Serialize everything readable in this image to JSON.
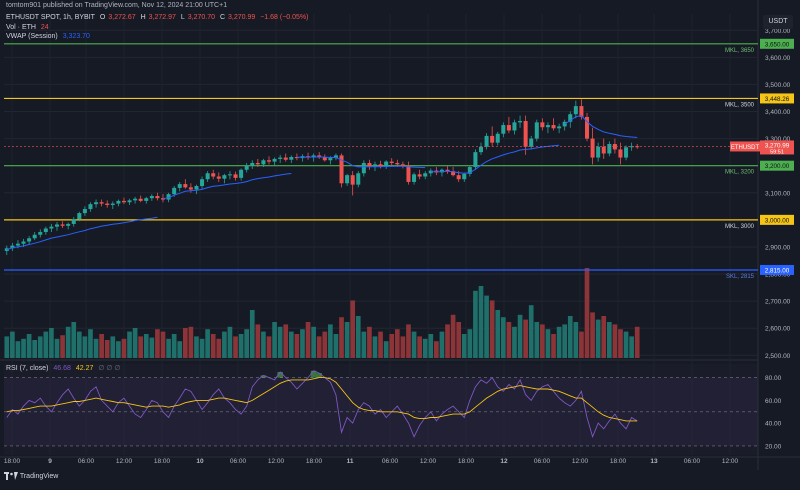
{
  "header": {
    "published": "tomtom901 published on TradingView.com, Nov 12, 2024 21:00 UTC+1",
    "symbol_line": "ETHUSDT SPOT, 1h, BYBIT",
    "o_label": "O",
    "o_value": "3,272.67",
    "h_label": "H",
    "h_value": "3,272.97",
    "l_label": "L",
    "l_value": "3,270.70",
    "c_label": "C",
    "c_value": "3,270.99",
    "change": "−1.68 (−0.05%)",
    "vol_label": "Vol · ETH",
    "vol_value": "24",
    "vwap_label": "VWAP (Session)",
    "vwap_value": "3,323.70",
    "rsi_label": "RSI (7, close)",
    "rsi_value1": "46.68",
    "rsi_value2": "42.27",
    "currency_badge": "USDT"
  },
  "footer": {
    "brand": "TradingView"
  },
  "colors": {
    "background": "#161a25",
    "up": "#26a69a",
    "down": "#ef5350",
    "up_volume": "#1f6f6a",
    "down_volume": "#8c3437",
    "vwap": "#2962ff",
    "green_level": "#4caf50",
    "yellow_level": "#f5c518",
    "blue_level": "#2962ff",
    "rsi_line": "#7e57c2",
    "rsi_ma": "#f5c518"
  },
  "chart_data": [
    {
      "type": "candlestick",
      "title": "ETHUSDT SPOT, 1h, BYBIT",
      "x_tick_labels": [
        "18:00",
        "9",
        "06:00",
        "12:00",
        "18:00",
        "10",
        "06:00",
        "12:00",
        "18:00",
        "11",
        "06:00",
        "12:00",
        "18:00",
        "12",
        "06:00",
        "12:00",
        "18:00",
        "13",
        "06:00",
        "12:00"
      ],
      "y_ticks": [
        "3,700.00",
        "3,600.00",
        "3,500.00",
        "3,400.00",
        "3,300.00",
        "3,200.00",
        "3,100.00",
        "3,000.00",
        "2,900.00",
        "2,800.00",
        "2,700.00",
        "2,600.00",
        "2,500.00"
      ],
      "ylim": [
        2490,
        3760
      ],
      "grid": true,
      "ohlc": [
        [
          2885,
          2905,
          2870,
          2895
        ],
        [
          2895,
          2915,
          2885,
          2905
        ],
        [
          2905,
          2925,
          2895,
          2912
        ],
        [
          2912,
          2930,
          2900,
          2920
        ],
        [
          2920,
          2940,
          2910,
          2932
        ],
        [
          2932,
          2955,
          2925,
          2945
        ],
        [
          2945,
          2965,
          2935,
          2955
        ],
        [
          2955,
          2975,
          2945,
          2968
        ],
        [
          2968,
          2985,
          2955,
          2975
        ],
        [
          2975,
          2992,
          2960,
          2983
        ],
        [
          2983,
          2995,
          2970,
          2978
        ],
        [
          2978,
          2990,
          2965,
          2985
        ],
        [
          2985,
          3010,
          2975,
          3002
        ],
        [
          3002,
          3030,
          2995,
          3025
        ],
        [
          3025,
          3050,
          3015,
          3040
        ],
        [
          3040,
          3065,
          3030,
          3058
        ],
        [
          3058,
          3075,
          3045,
          3065
        ],
        [
          3065,
          3075,
          3050,
          3060
        ],
        [
          3060,
          3072,
          3045,
          3055
        ],
        [
          3055,
          3068,
          3040,
          3060
        ],
        [
          3060,
          3075,
          3050,
          3070
        ],
        [
          3070,
          3082,
          3058,
          3065
        ],
        [
          3065,
          3078,
          3055,
          3072
        ],
        [
          3072,
          3085,
          3060,
          3078
        ],
        [
          3078,
          3090,
          3065,
          3070
        ],
        [
          3070,
          3085,
          3060,
          3080
        ],
        [
          3080,
          3095,
          3070,
          3088
        ],
        [
          3088,
          3100,
          3072,
          3080
        ],
        [
          3080,
          3095,
          3065,
          3075
        ],
        [
          3075,
          3100,
          3065,
          3095
        ],
        [
          3095,
          3125,
          3085,
          3118
        ],
        [
          3118,
          3140,
          3105,
          3132
        ],
        [
          3132,
          3150,
          3115,
          3120
        ],
        [
          3120,
          3135,
          3100,
          3112
        ],
        [
          3112,
          3130,
          3095,
          3125
        ],
        [
          3125,
          3160,
          3115,
          3150
        ],
        [
          3150,
          3180,
          3140,
          3172
        ],
        [
          3172,
          3185,
          3150,
          3160
        ],
        [
          3160,
          3175,
          3140,
          3152
        ],
        [
          3152,
          3170,
          3135,
          3165
        ],
        [
          3165,
          3180,
          3150,
          3168
        ],
        [
          3168,
          3178,
          3145,
          3155
        ],
        [
          3155,
          3190,
          3145,
          3185
        ],
        [
          3185,
          3210,
          3175,
          3200
        ],
        [
          3200,
          3220,
          3188,
          3210
        ],
        [
          3210,
          3225,
          3195,
          3205
        ],
        [
          3205,
          3225,
          3195,
          3220
        ],
        [
          3220,
          3235,
          3205,
          3215
        ],
        [
          3215,
          3230,
          3200,
          3225
        ],
        [
          3225,
          3240,
          3210,
          3230
        ],
        [
          3230,
          3245,
          3215,
          3222
        ],
        [
          3222,
          3238,
          3210,
          3232
        ],
        [
          3232,
          3245,
          3220,
          3228
        ],
        [
          3228,
          3242,
          3215,
          3235
        ],
        [
          3235,
          3248,
          3222,
          3230
        ],
        [
          3230,
          3245,
          3215,
          3238
        ],
        [
          3238,
          3250,
          3225,
          3232
        ],
        [
          3232,
          3242,
          3215,
          3220
        ],
        [
          3220,
          3235,
          3205,
          3228
        ],
        [
          3228,
          3245,
          3220,
          3238
        ],
        [
          3238,
          3245,
          3120,
          3135
        ],
        [
          3135,
          3170,
          3125,
          3165
        ],
        [
          3165,
          3180,
          3090,
          3130
        ],
        [
          3130,
          3180,
          3120,
          3172
        ],
        [
          3172,
          3220,
          3160,
          3210
        ],
        [
          3210,
          3222,
          3185,
          3198
        ],
        [
          3198,
          3215,
          3180,
          3205
        ],
        [
          3205,
          3218,
          3190,
          3195
        ],
        [
          3195,
          3220,
          3188,
          3215
        ],
        [
          3215,
          3228,
          3200,
          3210
        ],
        [
          3210,
          3222,
          3195,
          3205
        ],
        [
          3205,
          3215,
          3190,
          3200
        ],
        [
          3200,
          3215,
          3130,
          3140
        ],
        [
          3140,
          3175,
          3130,
          3168
        ],
        [
          3168,
          3185,
          3150,
          3160
        ],
        [
          3160,
          3180,
          3150,
          3172
        ],
        [
          3172,
          3190,
          3160,
          3182
        ],
        [
          3182,
          3195,
          3165,
          3175
        ],
        [
          3175,
          3190,
          3160,
          3185
        ],
        [
          3185,
          3200,
          3170,
          3180
        ],
        [
          3180,
          3195,
          3160,
          3165
        ],
        [
          3165,
          3180,
          3140,
          3150
        ],
        [
          3150,
          3175,
          3140,
          3170
        ],
        [
          3170,
          3200,
          3160,
          3195
        ],
        [
          3195,
          3260,
          3185,
          3250
        ],
        [
          3250,
          3285,
          3240,
          3270
        ],
        [
          3270,
          3320,
          3260,
          3310
        ],
        [
          3310,
          3345,
          3270,
          3285
        ],
        [
          3285,
          3325,
          3275,
          3318
        ],
        [
          3318,
          3360,
          3305,
          3350
        ],
        [
          3350,
          3380,
          3320,
          3330
        ],
        [
          3330,
          3370,
          3315,
          3360
        ],
        [
          3360,
          3385,
          3340,
          3365
        ],
        [
          3365,
          3385,
          3240,
          3270
        ],
        [
          3270,
          3310,
          3260,
          3300
        ],
        [
          3300,
          3370,
          3290,
          3360
        ],
        [
          3360,
          3375,
          3330,
          3342
        ],
        [
          3342,
          3360,
          3320,
          3350
        ],
        [
          3350,
          3375,
          3330,
          3338
        ],
        [
          3338,
          3355,
          3320,
          3345
        ],
        [
          3345,
          3370,
          3330,
          3362
        ],
        [
          3362,
          3400,
          3340,
          3390
        ],
        [
          3390,
          3440,
          3375,
          3420
        ],
        [
          3420,
          3445,
          3370,
          3380
        ],
        [
          3380,
          3395,
          3290,
          3300
        ],
        [
          3300,
          3340,
          3205,
          3230
        ],
        [
          3230,
          3285,
          3215,
          3270
        ],
        [
          3270,
          3300,
          3225,
          3245
        ],
        [
          3245,
          3290,
          3235,
          3280
        ],
        [
          3280,
          3300,
          3245,
          3260
        ],
        [
          3260,
          3285,
          3205,
          3230
        ],
        [
          3230,
          3275,
          3220,
          3268
        ],
        [
          3268,
          3285,
          3255,
          3272
        ],
        [
          3272,
          3280,
          3262,
          3271
        ]
      ],
      "vwap_note": "VWAP (Session)",
      "volume_label": "Vol · ETH",
      "volume": [
        18,
        22,
        14,
        16,
        20,
        15,
        18,
        22,
        25,
        16,
        19,
        26,
        30,
        22,
        18,
        24,
        16,
        20,
        15,
        18,
        14,
        16,
        22,
        25,
        18,
        20,
        17,
        24,
        22,
        16,
        20,
        14,
        25,
        26,
        18,
        16,
        24,
        20,
        16,
        22,
        26,
        18,
        20,
        24,
        40,
        28,
        22,
        18,
        30,
        26,
        28,
        22,
        20,
        24,
        30,
        26,
        18,
        22,
        28,
        20,
        34,
        30,
        48,
        35,
        22,
        26,
        18,
        22,
        14,
        20,
        24,
        18,
        28,
        22,
        18,
        16,
        20,
        14,
        22,
        28,
        36,
        30,
        20,
        24,
        56,
        60,
        52,
        48,
        40,
        34,
        30,
        26,
        36,
        32,
        44,
        30,
        28,
        24,
        20,
        26,
        28,
        35,
        30,
        22,
        75,
        38,
        32,
        35,
        30,
        28,
        24,
        22,
        18,
        26
      ],
      "horizontal_levels": [
        {
          "label": "MKL, 3650",
          "price": 3650,
          "price_label": "3,650.00",
          "color": "#4caf50"
        },
        {
          "label": "MKL, 3500",
          "price": 3448.26,
          "price_label": "3,448.26",
          "color": "#f5c518"
        },
        {
          "label": "MKL, 3200",
          "price": 3200,
          "price_label": "3,200.00",
          "color": "#4caf50"
        },
        {
          "label": "MKL, 3000",
          "price": 3000,
          "price_label": "3,000.00",
          "color": "#f5c518"
        },
        {
          "label": "SKL, 2815",
          "price": 2815,
          "price_label": "2,815.00",
          "color": "#2962ff"
        }
      ],
      "last_price": {
        "symbol": "ETHUSDT",
        "price": 3270.99,
        "price_label": "3,270.99",
        "countdown": "59:51"
      }
    },
    {
      "type": "line",
      "title": "RSI (7, close)",
      "y_ticks": [
        "80.00",
        "60.00",
        "40.00",
        "20.00"
      ],
      "ylim": [
        12,
        92
      ],
      "overbought": 80,
      "oversold": 20,
      "series": [
        {
          "name": "RSI",
          "values": [
            45,
            52,
            48,
            55,
            60,
            58,
            62,
            55,
            50,
            58,
            65,
            70,
            62,
            55,
            60,
            68,
            72,
            60,
            55,
            50,
            58,
            62,
            55,
            48,
            45,
            52,
            60,
            58,
            50,
            45,
            55,
            62,
            70,
            68,
            60,
            52,
            58,
            65,
            70,
            62,
            58,
            52,
            48,
            55,
            72,
            78,
            82,
            80,
            78,
            85,
            80,
            76,
            70,
            75,
            80,
            86,
            84,
            80,
            76,
            65,
            32,
            45,
            40,
            52,
            58,
            55,
            48,
            52,
            45,
            50,
            55,
            48,
            40,
            28,
            38,
            45,
            50,
            42,
            48,
            52,
            55,
            50,
            45,
            60,
            72,
            78,
            75,
            80,
            72,
            68,
            74,
            70,
            78,
            65,
            60,
            68,
            72,
            74,
            68,
            62,
            58,
            55,
            60,
            68,
            45,
            28,
            40,
            35,
            42,
            48,
            40,
            35,
            45,
            42
          ]
        },
        {
          "name": "MA",
          "values": [
            50,
            51,
            51,
            52,
            53,
            54,
            55,
            55,
            55,
            56,
            57,
            58,
            59,
            59,
            60,
            61,
            62,
            61,
            60,
            59,
            58,
            58,
            57,
            56,
            55,
            54,
            55,
            55,
            55,
            54,
            55,
            56,
            58,
            59,
            60,
            60,
            60,
            61,
            62,
            62,
            61,
            60,
            59,
            58,
            60,
            63,
            66,
            69,
            72,
            75,
            77,
            78,
            78,
            78,
            78,
            79,
            80,
            80,
            79,
            76,
            70,
            64,
            58,
            54,
            52,
            51,
            51,
            50,
            50,
            50,
            50,
            49,
            48,
            45,
            44,
            44,
            45,
            45,
            46,
            47,
            48,
            48,
            48,
            50,
            54,
            58,
            62,
            65,
            68,
            70,
            71,
            72,
            73,
            72,
            71,
            70,
            70,
            70,
            69,
            68,
            66,
            64,
            62,
            62,
            58,
            54,
            50,
            47,
            45,
            44,
            43,
            42,
            42,
            42
          ]
        }
      ]
    }
  ]
}
